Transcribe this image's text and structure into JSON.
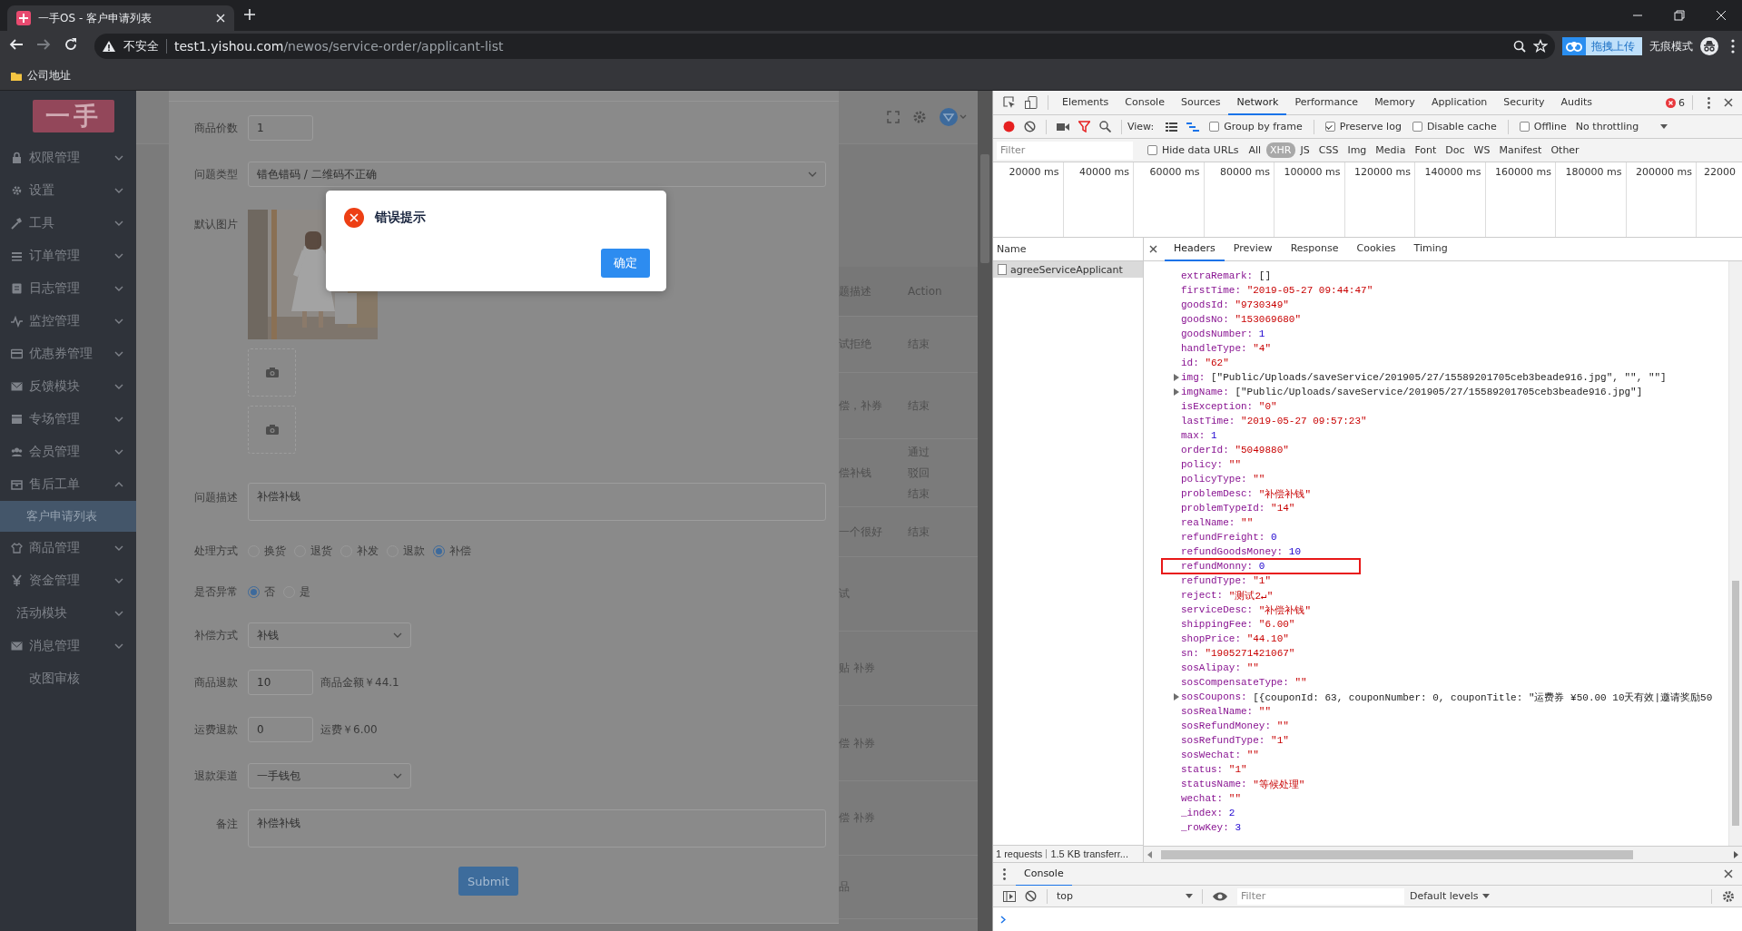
{
  "browser": {
    "tab_title": "一手OS - 客户申请列表",
    "security_label": "不安全",
    "url_host": "test1.yishou.com",
    "url_path": "/newos/service-order/applicant-list",
    "upload_button": "拖拽上传",
    "incognito_label": "无痕模式",
    "bookmarks": [
      "公司地址"
    ]
  },
  "sidebar": {
    "logo": "一手",
    "items": [
      {
        "label": "权限管理",
        "kind": "group",
        "expanded": false
      },
      {
        "label": "设置",
        "kind": "group",
        "expanded": false
      },
      {
        "label": "工具",
        "kind": "group",
        "expanded": false
      },
      {
        "label": "订单管理",
        "kind": "group",
        "expanded": false
      },
      {
        "label": "日志管理",
        "kind": "group",
        "expanded": false
      },
      {
        "label": "监控管理",
        "kind": "group",
        "expanded": false
      },
      {
        "label": "优惠券管理",
        "kind": "group",
        "expanded": false
      },
      {
        "label": "反馈模块",
        "kind": "group",
        "expanded": false
      },
      {
        "label": "专场管理",
        "kind": "group",
        "expanded": false
      },
      {
        "label": "会员管理",
        "kind": "group",
        "expanded": false
      },
      {
        "label": "售后工单",
        "kind": "group",
        "expanded": true,
        "children": [
          {
            "label": "客户申请列表",
            "selected": true
          }
        ]
      },
      {
        "label": "商品管理",
        "kind": "group",
        "expanded": false
      },
      {
        "label": "资金管理",
        "kind": "group",
        "expanded": false
      },
      {
        "label": "活动模块",
        "kind": "group",
        "expanded": false
      },
      {
        "label": "消息管理",
        "kind": "group",
        "expanded": false
      },
      {
        "label": "改图审核",
        "kind": "link"
      }
    ]
  },
  "background_table": {
    "headers": [
      "题描述",
      "Action"
    ],
    "rows": [
      {
        "cells": [
          "试拒绝"
        ],
        "actions": [
          "结束"
        ]
      },
      {
        "cells": [
          "偿，补券"
        ],
        "actions": [
          "结束"
        ]
      },
      {
        "cells": [
          "偿补钱"
        ],
        "actions": [
          "通过",
          "驳回",
          "结束"
        ]
      },
      {
        "cells": [
          "一个很好"
        ],
        "actions": [
          "结束"
        ]
      },
      {
        "cells": [
          "试"
        ]
      },
      {
        "cells": [
          "贴 补券"
        ]
      },
      {
        "cells": [
          "偿 补券"
        ]
      },
      {
        "cells": [
          "偿 补券"
        ]
      },
      {
        "cells": [
          "品"
        ]
      }
    ]
  },
  "form": {
    "fields": [
      {
        "kind": "input",
        "label": "商品价数",
        "value": "1"
      },
      {
        "kind": "wide-select",
        "label": "问题类型",
        "value": "错色错码 / 二维码不正确"
      },
      {
        "kind": "images",
        "label": "默认图片",
        "slots": [
          {
            "kind": "picture"
          },
          {
            "kind": "upload"
          },
          {
            "kind": "upload"
          }
        ]
      },
      {
        "kind": "textarea",
        "label": "问题描述",
        "value": "补偿补钱"
      },
      {
        "kind": "radios",
        "label": "处理方式",
        "options": [
          {
            "label": "换货",
            "selected": false
          },
          {
            "label": "退货",
            "selected": false
          },
          {
            "label": "补发",
            "selected": false
          },
          {
            "label": "退款",
            "selected": false
          },
          {
            "label": "补偿",
            "selected": true
          }
        ]
      },
      {
        "kind": "radios",
        "label": "是否异常",
        "options": [
          {
            "label": "否",
            "selected": true
          },
          {
            "label": "是",
            "selected": false
          }
        ]
      },
      {
        "kind": "select",
        "label": "补偿方式",
        "value": "补钱"
      },
      {
        "kind": "input",
        "label": "商品退款",
        "value": "10",
        "note": "商品金额￥44.1"
      },
      {
        "kind": "input",
        "label": "运费退款",
        "value": "0",
        "note": "运费￥6.00"
      },
      {
        "kind": "select",
        "label": "退款渠道",
        "value": "一手钱包"
      },
      {
        "kind": "textarea",
        "label": "备注",
        "value": "补偿补钱"
      }
    ],
    "submit": "Submit"
  },
  "dialog": {
    "title": "错误提示",
    "confirm": "确定"
  },
  "devtools": {
    "panel_tabs": [
      {
        "label": "Elements",
        "selected": false
      },
      {
        "label": "Console",
        "selected": false
      },
      {
        "label": "Sources",
        "selected": false
      },
      {
        "label": "Network",
        "selected": true
      },
      {
        "label": "Performance",
        "selected": false
      },
      {
        "label": "Memory",
        "selected": false
      },
      {
        "label": "Application",
        "selected": false
      },
      {
        "label": "Security",
        "selected": false
      },
      {
        "label": "Audits",
        "selected": false
      }
    ],
    "error_count": "6",
    "view_label": "View:",
    "checkboxes": [
      {
        "label": "Group by frame",
        "checked": false
      },
      {
        "label": "Preserve log",
        "checked": true
      },
      {
        "label": "Disable cache",
        "checked": false
      },
      {
        "label": "Offline",
        "checked": false
      }
    ],
    "throttling": "No throttling",
    "filter_placeholder": "Filter",
    "hide_data_urls": {
      "label": "Hide data URLs",
      "checked": false
    },
    "types": [
      {
        "label": "All",
        "selected": false
      },
      {
        "label": "XHR",
        "selected": true
      },
      {
        "label": "JS",
        "selected": false
      },
      {
        "label": "CSS",
        "selected": false
      },
      {
        "label": "Img",
        "selected": false
      },
      {
        "label": "Media",
        "selected": false
      },
      {
        "label": "Font",
        "selected": false
      },
      {
        "label": "Doc",
        "selected": false
      },
      {
        "label": "WS",
        "selected": false
      },
      {
        "label": "Manifest",
        "selected": false
      },
      {
        "label": "Other",
        "selected": false
      }
    ],
    "timeline_ticks": [
      "20000 ms",
      "40000 ms",
      "60000 ms",
      "80000 ms",
      "100000 ms",
      "120000 ms",
      "140000 ms",
      "160000 ms",
      "180000 ms",
      "200000 ms",
      "22000"
    ],
    "name_header": "Name",
    "requests": [
      {
        "name": "agreeServiceApplicant",
        "selected": true
      }
    ],
    "summary": "1 requests",
    "transferred": "1.5 KB transferr...",
    "detail_tabs": [
      {
        "label": "Headers",
        "selected": true
      },
      {
        "label": "Preview",
        "selected": false
      },
      {
        "label": "Response",
        "selected": false
      },
      {
        "label": "Cookies",
        "selected": false
      },
      {
        "label": "Timing",
        "selected": false
      }
    ],
    "lines": [
      {
        "key": "extraRemark:",
        "value": "[]",
        "kind": "object"
      },
      {
        "key": "firstTime:",
        "value": "\"2019-05-27 09:44:47\"",
        "kind": "string"
      },
      {
        "key": "goodsId:",
        "value": "\"9730349\"",
        "kind": "string"
      },
      {
        "key": "goodsNo:",
        "value": "\"153069680\"",
        "kind": "string"
      },
      {
        "key": "goodsNumber:",
        "value": "1",
        "kind": "number"
      },
      {
        "key": "handleType:",
        "value": "\"4\"",
        "kind": "string"
      },
      {
        "key": "id:",
        "value": "\"62\"",
        "kind": "string"
      },
      {
        "key": "img:",
        "value": "[\"Public/Uploads/saveService/201905/27/15589201705ceb3beade916.jpg\", \"\", \"\"]",
        "kind": "object",
        "expandable": true
      },
      {
        "key": "imgName:",
        "value": "[\"Public/Uploads/saveService/201905/27/15589201705ceb3beade916.jpg\"]",
        "kind": "object",
        "expandable": true
      },
      {
        "key": "isException:",
        "value": "\"0\"",
        "kind": "string"
      },
      {
        "key": "lastTime:",
        "value": "\"2019-05-27 09:57:23\"",
        "kind": "string"
      },
      {
        "key": "max:",
        "value": "1",
        "kind": "number"
      },
      {
        "key": "orderId:",
        "value": "\"5049880\"",
        "kind": "string"
      },
      {
        "key": "policy:",
        "value": "\"\"",
        "kind": "string"
      },
      {
        "key": "policyType:",
        "value": "\"\"",
        "kind": "string"
      },
      {
        "key": "problemDesc:",
        "value": "\"补偿补钱\"",
        "kind": "string"
      },
      {
        "key": "problemTypeId:",
        "value": "\"14\"",
        "kind": "string"
      },
      {
        "key": "realName:",
        "value": "\"\"",
        "kind": "string"
      },
      {
        "key": "refundFreight:",
        "value": "0",
        "kind": "number"
      },
      {
        "key": "refundGoodsMoney:",
        "value": "10",
        "kind": "number"
      },
      {
        "key": "refundMonny:",
        "value": "0",
        "kind": "number",
        "highlighted": true
      },
      {
        "key": "refundType:",
        "value": "\"1\"",
        "kind": "string"
      },
      {
        "key": "reject:",
        "value": "\"测试2↵\"",
        "kind": "string"
      },
      {
        "key": "serviceDesc:",
        "value": "\"补偿补钱\"",
        "kind": "string"
      },
      {
        "key": "shippingFee:",
        "value": "\"6.00\"",
        "kind": "string"
      },
      {
        "key": "shopPrice:",
        "value": "\"44.10\"",
        "kind": "string"
      },
      {
        "key": "sn:",
        "value": "\"1905271421067\"",
        "kind": "string"
      },
      {
        "key": "sosAlipay:",
        "value": "\"\"",
        "kind": "string"
      },
      {
        "key": "sosCompensateType:",
        "value": "\"\"",
        "kind": "string"
      },
      {
        "key": "sosCoupons:",
        "value": "[{couponId: 63, couponNumber: 0, couponTitle: \"运费券 ¥50.00 10天有效|邀请奖励50",
        "kind": "object",
        "expandable": true
      },
      {
        "key": "sosRealName:",
        "value": "\"\"",
        "kind": "string"
      },
      {
        "key": "sosRefundMoney:",
        "value": "\"\"",
        "kind": "string"
      },
      {
        "key": "sosRefundType:",
        "value": "\"1\"",
        "kind": "string"
      },
      {
        "key": "sosWechat:",
        "value": "\"\"",
        "kind": "string"
      },
      {
        "key": "status:",
        "value": "\"1\"",
        "kind": "string"
      },
      {
        "key": "statusName:",
        "value": "\"等候处理\"",
        "kind": "string"
      },
      {
        "key": "wechat:",
        "value": "\"\"",
        "kind": "string"
      },
      {
        "key": "_index:",
        "value": "2",
        "kind": "number"
      },
      {
        "key": "_rowKey:",
        "value": "3",
        "kind": "number"
      }
    ],
    "console": {
      "tab": "Console",
      "context": "top",
      "filter_placeholder": "Filter",
      "levels": "Default levels"
    }
  }
}
